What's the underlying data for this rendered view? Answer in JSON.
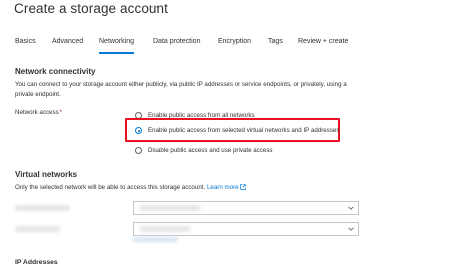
{
  "page": {
    "title": "Create a storage account",
    "more": "···"
  },
  "tabs": [
    {
      "label": "Basics"
    },
    {
      "label": "Advanced"
    },
    {
      "label": "Networking"
    },
    {
      "label": "Data protection"
    },
    {
      "label": "Encryption"
    },
    {
      "label": "Tags"
    },
    {
      "label": "Review + create"
    }
  ],
  "network_connectivity": {
    "heading": "Network connectivity",
    "description_line1": "You can connect to your storage account either publicly, via public IP addresses or service endpoints, or privately, using a",
    "description_line2": "private endpoint.",
    "access_label": "Network access",
    "required_marker": "*",
    "options": [
      {
        "label": "Enable public access from all networks",
        "selected": false
      },
      {
        "label": "Enable public access from selected virtual networks and IP addresses",
        "selected": true
      },
      {
        "label": "Disable public access and use private access",
        "selected": false
      }
    ]
  },
  "virtual_networks": {
    "heading": "Virtual networks",
    "description": "Only the selected network will be able to access this storage account.",
    "learn_more": "Learn more",
    "external_icon": "external-link-icon"
  },
  "ip_addresses": {
    "heading": "IP Addresses"
  },
  "colors": {
    "accent": "#0078d4",
    "highlight": "#e81123",
    "required": "#a4262c"
  }
}
